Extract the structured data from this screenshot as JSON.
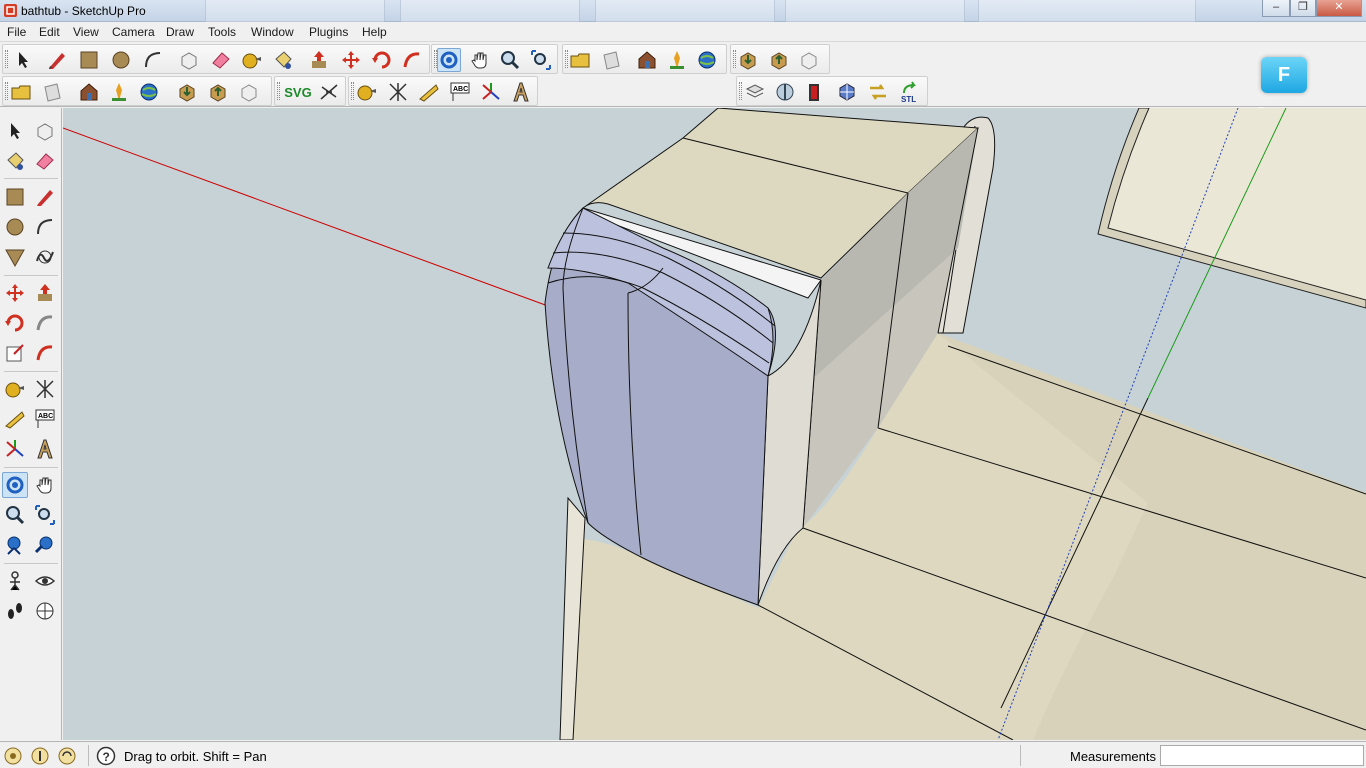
{
  "window": {
    "title": "bathtub - SketchUp Pro",
    "controls": {
      "minimize": "–",
      "maximize": "❐",
      "close": "✕"
    }
  },
  "menu": {
    "items": [
      "File",
      "Edit",
      "View",
      "Camera",
      "Draw",
      "Tools",
      "Window",
      "Plugins",
      "Help"
    ]
  },
  "toolbar": {
    "svg_label": "SVG",
    "stl_label": "STL",
    "text_tool_label": "ABC",
    "badge_letter": "F"
  },
  "left_toolbar": {
    "text_tool_label": "ABC"
  },
  "statusbar": {
    "hint": "Drag to orbit.  Shift = Pan",
    "measurements_label": "Measurements",
    "measurements_value": ""
  },
  "colors": {
    "sky": "#c6d2d6",
    "ground_face": "#ded9c0",
    "selected_face": "#a8aec8",
    "red_axis": "#cc0000",
    "green_axis": "#1a9c1a",
    "blue_axis": "#2040c0"
  }
}
